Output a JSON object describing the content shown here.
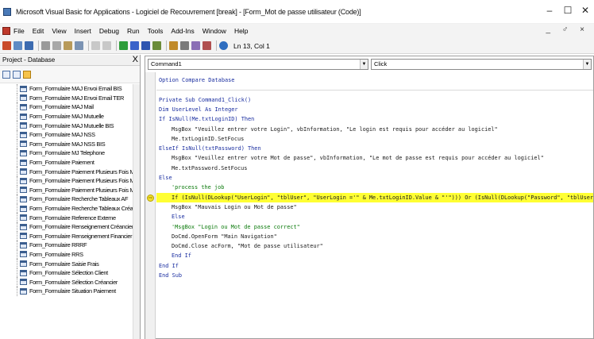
{
  "window": {
    "title": "Microsoft Visual Basic for Applications - Logiciel de Recouvrement [break] - [Form_Mot de passe utilisateur (Code)]",
    "controls": {
      "minimize": "–",
      "maximize": "☐",
      "close": "✕"
    }
  },
  "menubar": {
    "items": [
      "File",
      "Edit",
      "View",
      "Insert",
      "Debug",
      "Run",
      "Tools",
      "Add-Ins",
      "Window",
      "Help"
    ],
    "mdi_controls": "_ ♂ ×"
  },
  "toolbar": {
    "position": "Ln 13, Col 1"
  },
  "project": {
    "header": "Project - Database",
    "close": "X",
    "items": [
      "Form_Formulaire MAJ Envoi Email BIS",
      "Form_Formulaire MAJ Envoi Email TER",
      "Form_Formulaire MAJ Mail",
      "Form_Formulaire MAJ Mutuelle",
      "Form_Formulaire MAJ Mutuelle BIS",
      "Form_Formulaire MAJ NSS",
      "Form_Formulaire MAJ NSS BIS",
      "Form_Formulaire MJ Telephone",
      "Form_Formulaire Paiement",
      "Form_Formulaire Paiement Plusieurs Fois Mail",
      "Form_Formulaire Paiement Plusieurs Fois Mail BIS",
      "Form_Formulaire Paiement Plusieurs Fois Mail TER",
      "Form_Formulaire Recherche Tableaux AF",
      "Form_Formulaire Recherche Tableaux Créancier",
      "Form_Formulaire Reference Externe",
      "Form_Formulaire Renseignement Créancier",
      "Form_Formulaire Renseignement Financier",
      "Form_Formulaire RRRF",
      "Form_Formulaire RRS",
      "Form_Formulaire Saisie Frais",
      "Form_Formulaire Sélection Client",
      "Form_Formulaire Sélection Créancier",
      "Form_Formulaire Situation Paiement"
    ]
  },
  "code": {
    "object_combo": "Command1",
    "proc_combo": "Click",
    "lines": [
      {
        "text": "Option Compare Database",
        "indent": 0,
        "kind": "kw"
      },
      {
        "text": "",
        "indent": 0,
        "kind": "sep"
      },
      {
        "text": "Private Sub Command1_Click()",
        "indent": 0,
        "kind": "kw"
      },
      {
        "text": "Dim UserLevel As Integer",
        "indent": 0,
        "kind": "kw"
      },
      {
        "text": "If IsNull(Me.txtLoginID) Then",
        "indent": 0,
        "kind": "kw"
      },
      {
        "text": "MsgBox \"Veuillez entrer votre Login\", vbInformation, \"Le login est requis pour accéder au logiciel\"",
        "indent": 1,
        "kind": "normal"
      },
      {
        "text": "Me.txtLoginID.SetFocus",
        "indent": 1,
        "kind": "normal"
      },
      {
        "text": "ElseIf IsNull(txtPassword) Then",
        "indent": 0,
        "kind": "kw"
      },
      {
        "text": "MsgBox \"Veuillez entrer votre Mot de passe\", vbInformation, \"Le mot de passe est requis pour accéder au logiciel\"",
        "indent": 1,
        "kind": "normal"
      },
      {
        "text": "Me.txtPassword.SetFocus",
        "indent": 1,
        "kind": "normal"
      },
      {
        "text": "Else",
        "indent": 0,
        "kind": "kw"
      },
      {
        "text": "'process the job",
        "indent": 1,
        "kind": "cm"
      },
      {
        "text": "If (IsNull(DLookup(\"UserLogin\", \"tblUser\", \"UserLogin ='\" & Me.txtLoginID.Value & \"'\"))) Or (IsNull(DLookup(\"Password\", \"tblUser\", \"",
        "indent": 1,
        "kind": "hl"
      },
      {
        "text": "MsgBox \"Mauvais Login ou Mot de passe\"",
        "indent": 1,
        "kind": "normal"
      },
      {
        "text": "Else",
        "indent": 1,
        "kind": "kw"
      },
      {
        "text": "'MsgBox \"Login ou Mot de passe correct\"",
        "indent": 1,
        "kind": "cm"
      },
      {
        "text": "DoCmd.OpenForm \"Main Navigation\"",
        "indent": 1,
        "kind": "normal"
      },
      {
        "text": "DoCmd.Close acForm, \"Mot de passe utilisateur\"",
        "indent": 1,
        "kind": "normal"
      },
      {
        "text": "End If",
        "indent": 1,
        "kind": "kw"
      },
      {
        "text": "End If",
        "indent": 0,
        "kind": "kw"
      },
      {
        "text": "End Sub",
        "indent": 0,
        "kind": "kw"
      }
    ]
  },
  "colors": {
    "highlight": "#ffff33",
    "keyword": "#1a2ea0",
    "comment": "#0b7a0b"
  }
}
